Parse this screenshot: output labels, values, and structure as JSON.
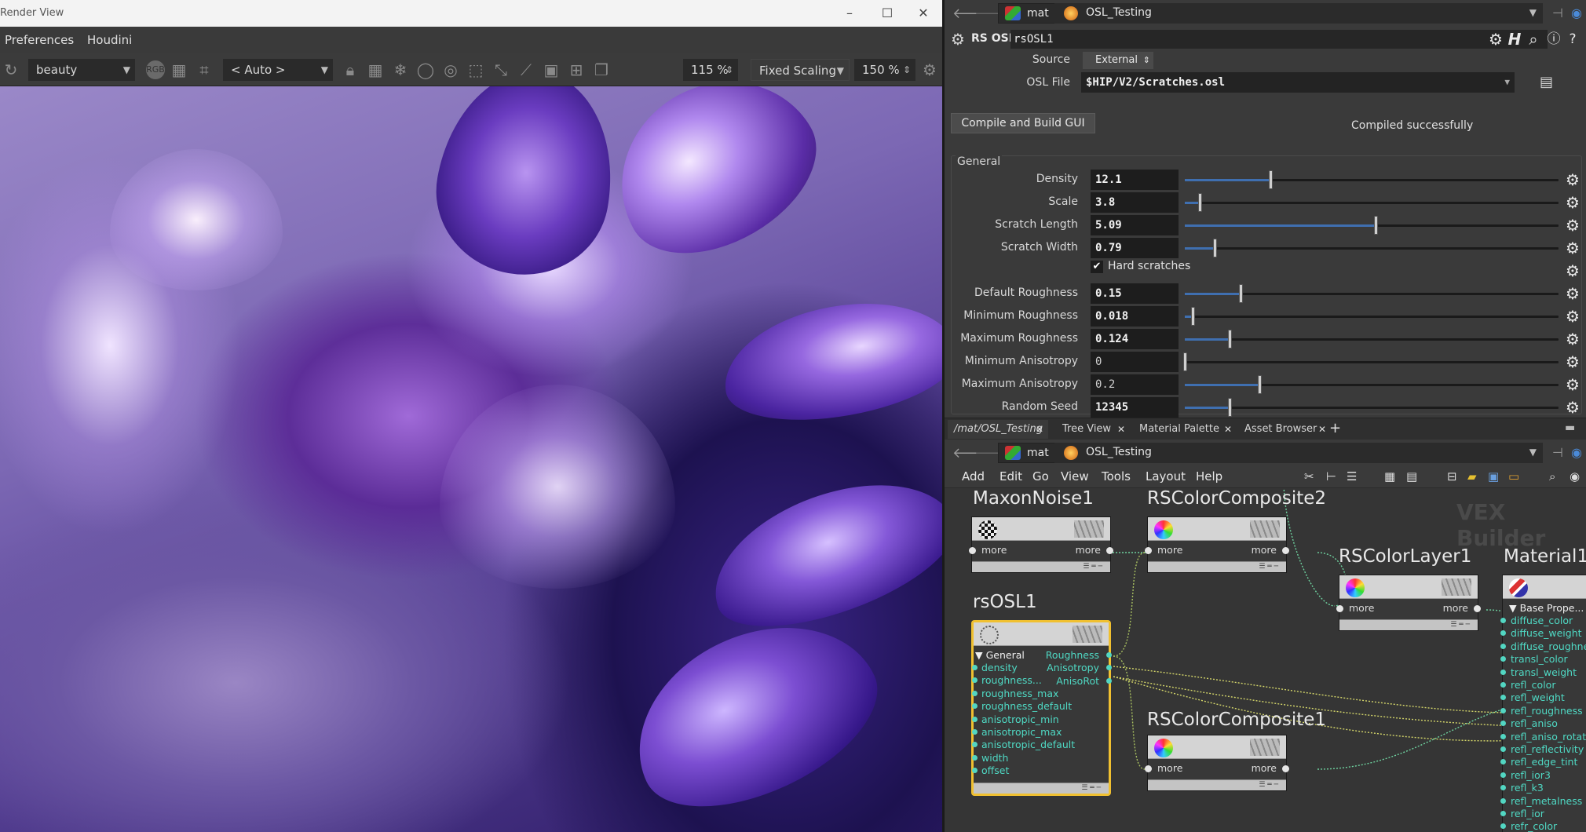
{
  "render_view": {
    "title": "Render View",
    "menu": [
      "Preferences",
      "Houdini"
    ],
    "toolbar": {
      "aov": "beauty",
      "camera": "< Auto >",
      "zoom": "115 %",
      "scaling_mode": "Fixed Scaling",
      "scale": "150 %"
    }
  },
  "parm_pane": {
    "path": {
      "root": "mat",
      "node": "OSL_Testing"
    },
    "node_type": "RS OSL",
    "node_name": "rsOSL1",
    "source_label": "Source",
    "source_value": "External",
    "osl_file_label": "OSL File",
    "osl_file_value": "$HIP/V2/Scratches.osl",
    "compile_button": "Compile and Build GUI",
    "compile_status": "Compiled successfully",
    "group_label": "General",
    "params": [
      {
        "label": "Density",
        "value": "12.1",
        "fill": 0.23
      },
      {
        "label": "Scale",
        "value": "3.8",
        "fill": 0.04
      },
      {
        "label": "Scratch Length",
        "value": "5.09",
        "fill": 0.51
      },
      {
        "label": "Scratch Width",
        "value": "0.79",
        "fill": 0.08
      },
      {
        "label": "",
        "value": "",
        "fill": null
      },
      {
        "label": "Default Roughness",
        "value": "0.15",
        "fill": 0.15
      },
      {
        "label": "Minimum Roughness",
        "value": "0.018",
        "fill": 0.02
      },
      {
        "label": "Maximum Roughness",
        "value": "0.124",
        "fill": 0.12
      },
      {
        "label": "Minimum Anisotropy",
        "value": "0",
        "fill": 0.0
      },
      {
        "label": "Maximum Anisotropy",
        "value": "0.2",
        "fill": 0.2
      },
      {
        "label": "Random Seed",
        "value": "12345",
        "fill": 0.12
      }
    ],
    "toggle_label": "Hard scratches",
    "toggle_checked": true
  },
  "tabs": [
    {
      "label": "/mat/OSL_Testing",
      "active": true
    },
    {
      "label": "Tree View",
      "active": false
    },
    {
      "label": "Material Palette",
      "active": false
    },
    {
      "label": "Asset Browser",
      "active": false
    }
  ],
  "network": {
    "path": {
      "root": "mat",
      "node": "OSL_Testing"
    },
    "menu": [
      "Add",
      "Edit",
      "Go",
      "View",
      "Tools",
      "Layout",
      "Help"
    ],
    "watermark": "VEX Builder",
    "nodes": {
      "maxon": {
        "title": "MaxonNoise1",
        "in": "more",
        "out": "more"
      },
      "comp2": {
        "title": "RSColorComposite2",
        "in": "more",
        "out": "more"
      },
      "layer1": {
        "title": "RSColorLayer1",
        "in": "more",
        "out": "more"
      },
      "material1": {
        "title": "Material1",
        "group": "Base Prope..."
      },
      "comp1": {
        "title": "RSColorComposite1",
        "in": "more",
        "out": "more"
      },
      "rsosl": {
        "title": "rsOSL1",
        "group": "General",
        "inputs": [
          "density",
          "roughness...",
          "roughness_max",
          "roughness_default",
          "anisotropic_min",
          "anisotropic_max",
          "anisotropic_default",
          "width",
          "offset"
        ],
        "outputs": [
          "Roughness",
          "Anisotropy",
          "AnisoRot"
        ]
      }
    },
    "material_inputs": [
      "diffuse_color",
      "diffuse_weight",
      "diffuse_roughness",
      "transl_color",
      "transl_weight",
      "refl_color",
      "refl_weight",
      "refl_roughness",
      "refl_aniso",
      "refl_aniso_rotation",
      "refl_reflectivity",
      "refl_edge_tint",
      "refl_ior3",
      "refl_k3",
      "refl_metalness",
      "refl_ior",
      "refr_color"
    ]
  }
}
